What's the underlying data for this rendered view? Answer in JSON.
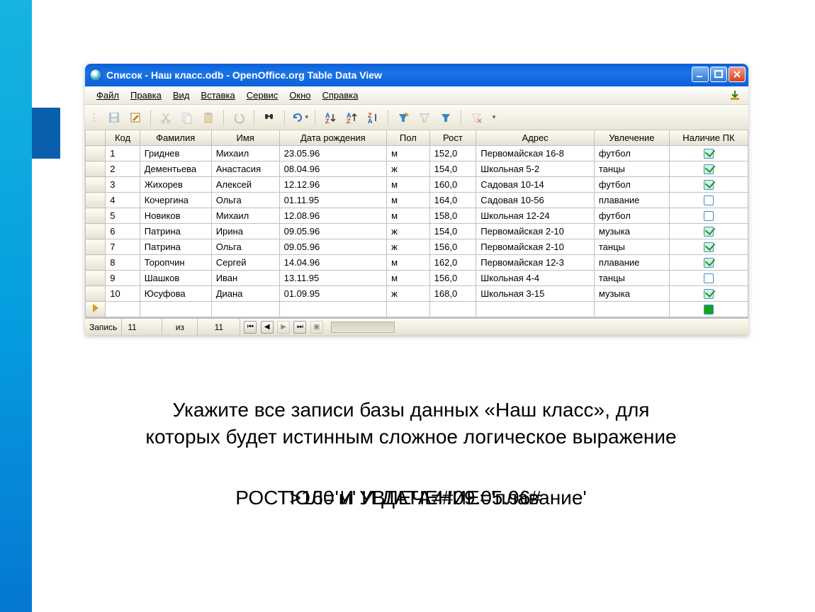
{
  "window": {
    "title": "Список - Наш класс.odb - OpenOffice.org Table Data View"
  },
  "menu": {
    "file": "Файл",
    "edit": "Правка",
    "view": "Вид",
    "insert": "Вставка",
    "service": "Сервис",
    "window": "Окно",
    "help": "Справка"
  },
  "headers": [
    "Код",
    "Фамилия",
    "Имя",
    "Дата рождения",
    "Пол",
    "Рост",
    "Адрес",
    "Увлечение",
    "Наличие ПК"
  ],
  "rows": [
    {
      "id": "1",
      "lname": "Гриднев",
      "fname": "Михаил",
      "dob": "23.05.96",
      "sex": "м",
      "height": "152,0",
      "addr": "Первомайская 16-8",
      "hobby": "футбол",
      "pc": true
    },
    {
      "id": "2",
      "lname": "Дементьева",
      "fname": "Анастасия",
      "dob": "08.04.96",
      "sex": "ж",
      "height": "154,0",
      "addr": "Школьная 5-2",
      "hobby": "танцы",
      "pc": true
    },
    {
      "id": "3",
      "lname": "Жихорев",
      "fname": "Алексей",
      "dob": "12.12.96",
      "sex": "м",
      "height": "160,0",
      "addr": "Садовая 10-14",
      "hobby": "футбол",
      "pc": true
    },
    {
      "id": "4",
      "lname": "Кочергина",
      "fname": "Ольга",
      "dob": "01.11.95",
      "sex": "м",
      "height": "164,0",
      "addr": "Садовая 10-56",
      "hobby": "плавание",
      "pc": false
    },
    {
      "id": "5",
      "lname": "Новиков",
      "fname": "Михаил",
      "dob": "12.08.96",
      "sex": "м",
      "height": "158,0",
      "addr": "Школьная 12-24",
      "hobby": "футбол",
      "pc": false
    },
    {
      "id": "6",
      "lname": "Патрина",
      "fname": "Ирина",
      "dob": "09.05.96",
      "sex": "ж",
      "height": "154,0",
      "addr": "Первомайская 2-10",
      "hobby": "музыка",
      "pc": true
    },
    {
      "id": "7",
      "lname": "Патрина",
      "fname": "Ольга",
      "dob": "09.05.96",
      "sex": "ж",
      "height": "156,0",
      "addr": "Первомайская 2-10",
      "hobby": "танцы",
      "pc": true
    },
    {
      "id": "8",
      "lname": "Торопчин",
      "fname": "Сергей",
      "dob": "14.04.96",
      "sex": "м",
      "height": "162,0",
      "addr": "Первомайская 12-3",
      "hobby": "плавание",
      "pc": true
    },
    {
      "id": "9",
      "lname": "Шашков",
      "fname": "Иван",
      "dob": "13.11.95",
      "sex": "м",
      "height": "156,0",
      "addr": "Школьная 4-4",
      "hobby": "танцы",
      "pc": false
    },
    {
      "id": "10",
      "lname": "Юсуфова",
      "fname": "Диана",
      "dob": "01.09.95",
      "sex": "ж",
      "height": "168,0",
      "addr": "Школьная 3-15",
      "hobby": "музыка",
      "pc": true
    }
  ],
  "navbar": {
    "record_label": "Запись",
    "record_value": "11",
    "of_label": "из",
    "total": "11"
  },
  "caption": {
    "line1": "Укажите все записи базы данных «Наш класс», для",
    "line2": "которых будет истинным сложное логическое выражение",
    "expr_a": "РОСТ>160 И УВЛЕЧЕНИЕ='плавание'",
    "expr_b": "ПОЛ='м' И ДАТА≠#09.05.96#"
  }
}
